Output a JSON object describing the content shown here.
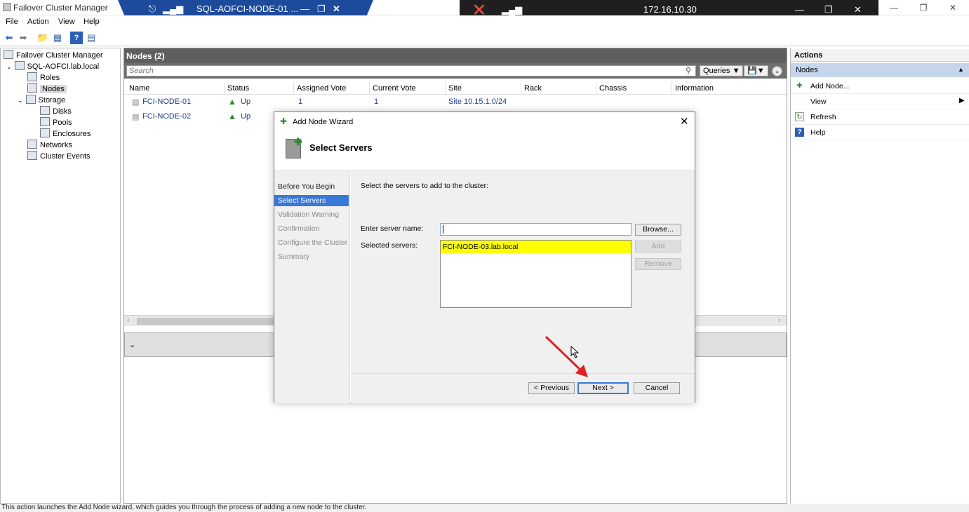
{
  "app": {
    "title": "Failover Cluster Manager"
  },
  "rdp": {
    "session_title": "SQL-AOFCI-NODE-01 ...",
    "ip": "172.16.10.30"
  },
  "menu": [
    "File",
    "Action",
    "View",
    "Help"
  ],
  "tree": {
    "root": "Failover Cluster Manager",
    "cluster": "SQL-AOFCI.lab.local",
    "roles": "Roles",
    "nodes": "Nodes",
    "storage": "Storage",
    "disks": "Disks",
    "pools": "Pools",
    "enclosures": "Enclosures",
    "networks": "Networks",
    "cluster_events": "Cluster Events"
  },
  "center": {
    "title": "Nodes (2)",
    "search_placeholder": "Search",
    "queries_label": "Queries",
    "columns": [
      "Name",
      "Status",
      "Assigned Vote",
      "Current Vote",
      "Site",
      "Rack",
      "Chassis",
      "Information"
    ],
    "rows": [
      {
        "name": "FCI-NODE-01",
        "status": "Up",
        "assigned_vote": "1",
        "current_vote": "1",
        "site": "Site 10.15.1.0/24"
      },
      {
        "name": "FCI-NODE-02",
        "status": "Up",
        "assigned_vote": "",
        "current_vote": "",
        "site": ""
      }
    ]
  },
  "actions": {
    "title": "Actions",
    "section": "Nodes",
    "items": [
      "Add Node...",
      "View",
      "Refresh",
      "Help"
    ]
  },
  "dialog": {
    "title": "Add Node Wizard",
    "heading": "Select Servers",
    "steps": [
      "Before You Begin",
      "Select Servers",
      "Validation Warning",
      "Confirmation",
      "Configure the Cluster",
      "Summary"
    ],
    "active_step": 1,
    "instruction": "Select the servers to add to the cluster:",
    "server_name_label": "Enter server name:",
    "server_name_value": "",
    "selected_label": "Selected servers:",
    "selected_servers": [
      "FCI-NODE-03.lab.local"
    ],
    "browse_label": "Browse...",
    "add_label": "Add",
    "remove_label": "Remove",
    "previous_label": "< Previous",
    "next_label": "Next >",
    "cancel_label": "Cancel"
  },
  "status_text": "This action launches the Add Node wizard, which guides you through the process of adding a new node to the cluster.",
  "colors": {
    "accent": "#3a78d8",
    "rdp_bar": "#1e4a9c",
    "highlight": "#ffff00",
    "annotation_arrow": "#e02020"
  }
}
